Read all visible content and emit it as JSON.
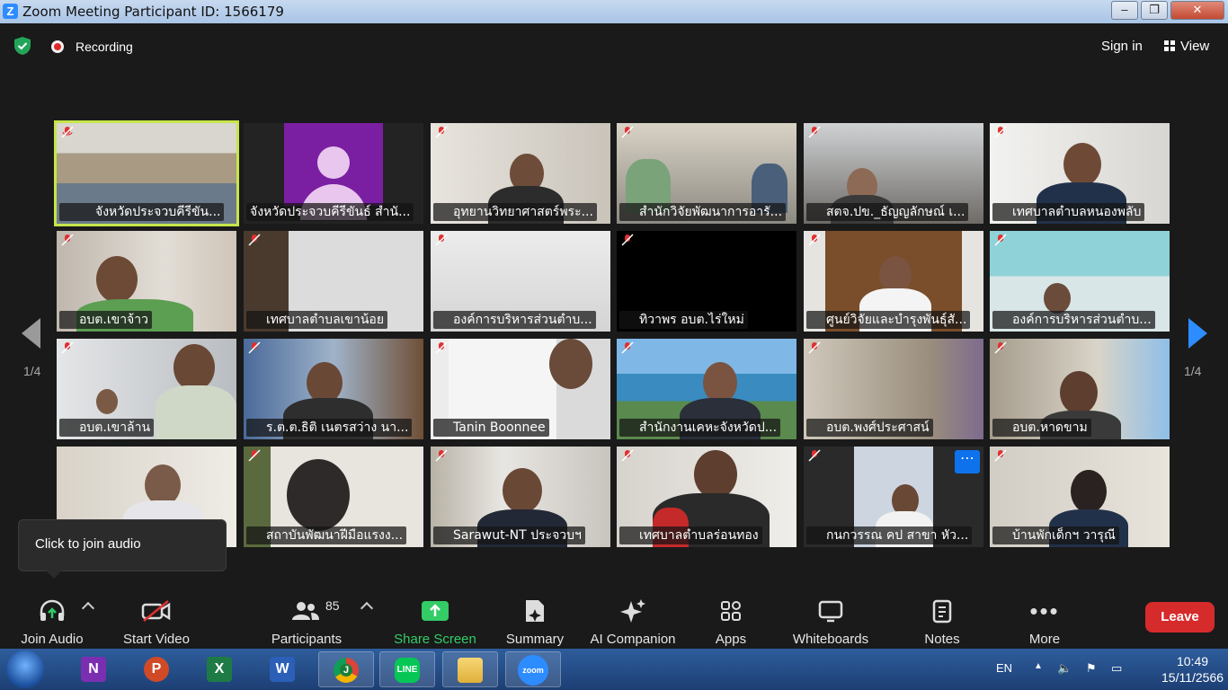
{
  "window": {
    "title": "Zoom Meeting Participant ID: 1566179"
  },
  "topbar": {
    "recording_label": "Recording",
    "signin_label": "Sign in",
    "view_label": "View"
  },
  "gallery": {
    "page_left": "1/4",
    "page_right": "1/4",
    "tiles": [
      "จังหวัดประจวบคีรีขัน...",
      "จังหวัดประจวบคีรีขันธ์ สำนั...",
      "อุทยานวิทยาศาสตร์พระ...",
      "สำนักวิจัยพัฒนาการอารั...",
      "สตจ.ปข._ธัญญลักษณ์ เ...",
      "เทศบาลตำบลหนองพลับ",
      "อบต.เขาจ้าว",
      "เทศบาลตำบลเขาน้อย",
      "องค์การบริหารส่วนตำบ...",
      "ทิวาพร  อบต.ไร่ใหม่",
      "ศูนย์วิจัยและบำรุงพันธุ์สั...",
      "องค์การบริหารส่วนตำบ...",
      "อบต.เขาล้าน",
      "ร.ต.ต.ธิติ เนตรสว่าง นา...",
      "Tanin Boonnee",
      "สำนักงานเคหะจังหวัดป...",
      "อบต.พงศ์ประศาสน์",
      "อบต.หาดขาม",
      "",
      "สถาบันพัฒนาฝีมือแรงง...",
      "Sarawut-NT ประจวบฯ",
      "เทศบาลตำบลร่อนทอง",
      "กนกวรรณ คป สาขา หัว...",
      "บ้านพักเด็กฯ วารุณี"
    ]
  },
  "tooltip": {
    "text": "Click to join audio"
  },
  "toolbar": {
    "join_audio": "Join Audio",
    "start_video": "Start Video",
    "participants": "Participants",
    "participants_count": "85",
    "share_screen": "Share Screen",
    "summary": "Summary",
    "ai_companion": "AI Companion",
    "apps": "Apps",
    "whiteboards": "Whiteboards",
    "notes": "Notes",
    "more": "More",
    "leave": "Leave"
  },
  "taskbar": {
    "language": "EN",
    "time": "10:49",
    "date": "15/11/2566",
    "apps": [
      "N",
      "P",
      "X",
      "W",
      "J",
      "LINE",
      "",
      "zoom"
    ]
  },
  "colors": {
    "accent": "#2d8cff",
    "active_speaker": "#c6e54a",
    "leave": "#d62b2b",
    "share": "#33cc66"
  }
}
